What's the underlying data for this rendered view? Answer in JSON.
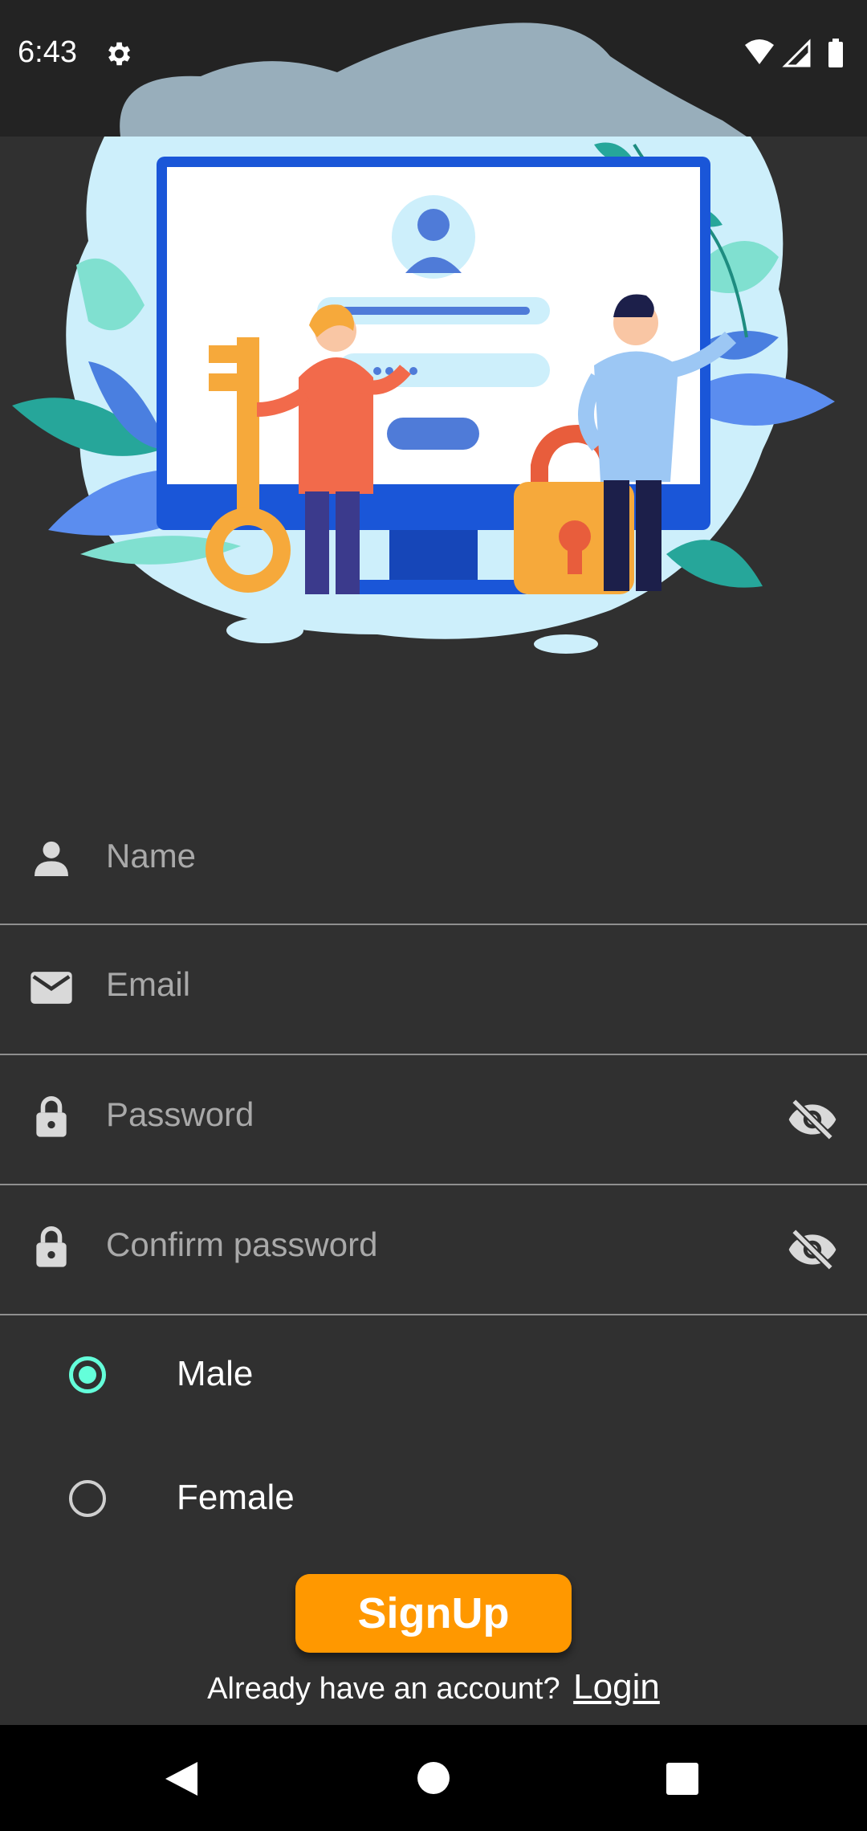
{
  "status_bar": {
    "time": "6:43",
    "icons": [
      "gear-icon",
      "wifi-icon",
      "cell-signal-icon",
      "battery-icon"
    ]
  },
  "form": {
    "name_placeholder": "Name",
    "email_placeholder": "Email",
    "password_placeholder": "Password",
    "confirm_password_placeholder": "Confirm password"
  },
  "gender": {
    "options": [
      "Male",
      "Female"
    ],
    "selected": "Male"
  },
  "actions": {
    "signup_label": "SignUp",
    "login_prompt": "Already have an account?",
    "login_link": "Login"
  },
  "colors": {
    "accent": "#ff9800",
    "radio_selected": "#64ffda",
    "background": "#303030"
  }
}
